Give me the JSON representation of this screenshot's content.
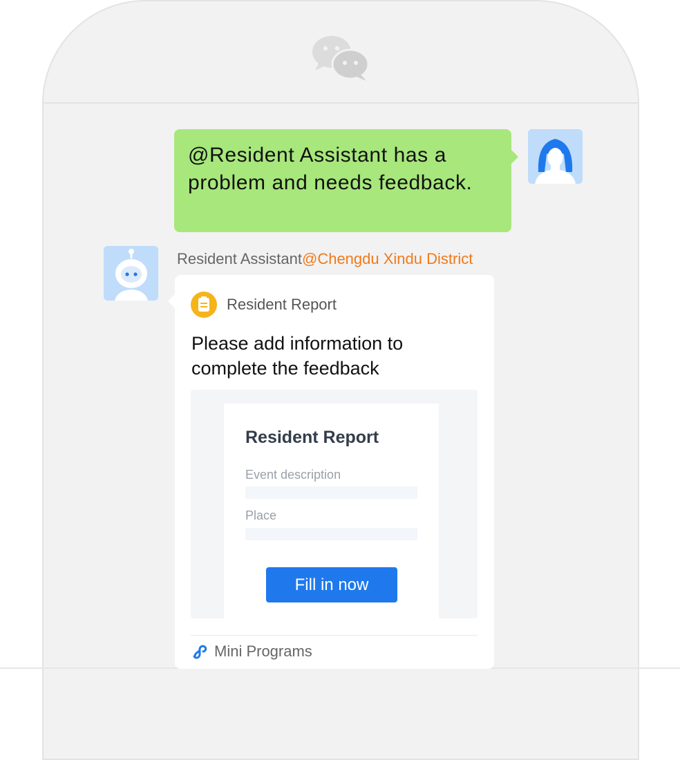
{
  "chat": {
    "outgoing_message": "@Resident Assistant has a problem and needs feedback.",
    "sender_name": "Resident Assistant",
    "sender_org": "@Chengdu Xindu District"
  },
  "card": {
    "source_name": "Resident Report",
    "title": "Please add information to complete the feedback",
    "form": {
      "title": "Resident Report",
      "fields": [
        {
          "label": "Event description"
        },
        {
          "label": "Place"
        }
      ],
      "button_label": "Fill in now"
    },
    "footer_label": "Mini Programs"
  },
  "icons": {
    "header": "wechat-logo-icon",
    "user_avatar": "user-avatar-icon",
    "bot_avatar": "robot-avatar-icon",
    "card_badge": "report-document-icon",
    "footer": "mini-programs-icon"
  },
  "colors": {
    "outgoing_bubble": "#a7e77b",
    "sender_org": "#f07a1a",
    "primary_button": "#1f79ec",
    "badge": "#f6b41b"
  }
}
